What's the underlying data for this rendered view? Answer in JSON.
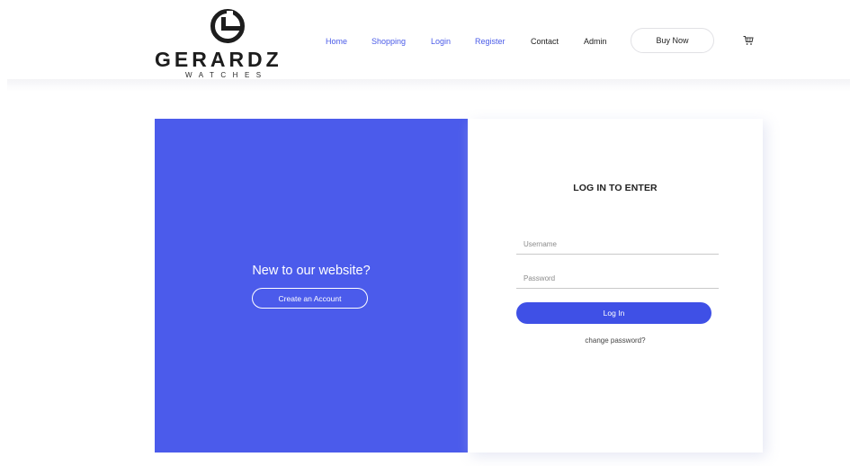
{
  "brand": {
    "name": "GERARDZ",
    "tagline": "WATCHES",
    "logo_icon": "g-monogram-icon"
  },
  "nav": {
    "items": [
      {
        "label": "Home",
        "active": true
      },
      {
        "label": "Shopping",
        "active": true
      },
      {
        "label": "Login",
        "active": true
      },
      {
        "label": "Register",
        "active": true
      },
      {
        "label": "Contact",
        "active": false
      },
      {
        "label": "Admin",
        "active": false
      }
    ],
    "cta_label": "Buy Now",
    "cart_icon": "cart-icon"
  },
  "signup_panel": {
    "heading": "New to our website?",
    "button_label": "Create an Account"
  },
  "login_panel": {
    "heading": "LOG IN TO ENTER",
    "username_placeholder": "Username",
    "password_placeholder": "Password",
    "submit_label": "Log In",
    "change_password_label": "change password?"
  },
  "colors": {
    "accent_blue": "#4b5beb",
    "button_blue": "#3f50e6",
    "nav_link_blue": "#4a5be8"
  }
}
